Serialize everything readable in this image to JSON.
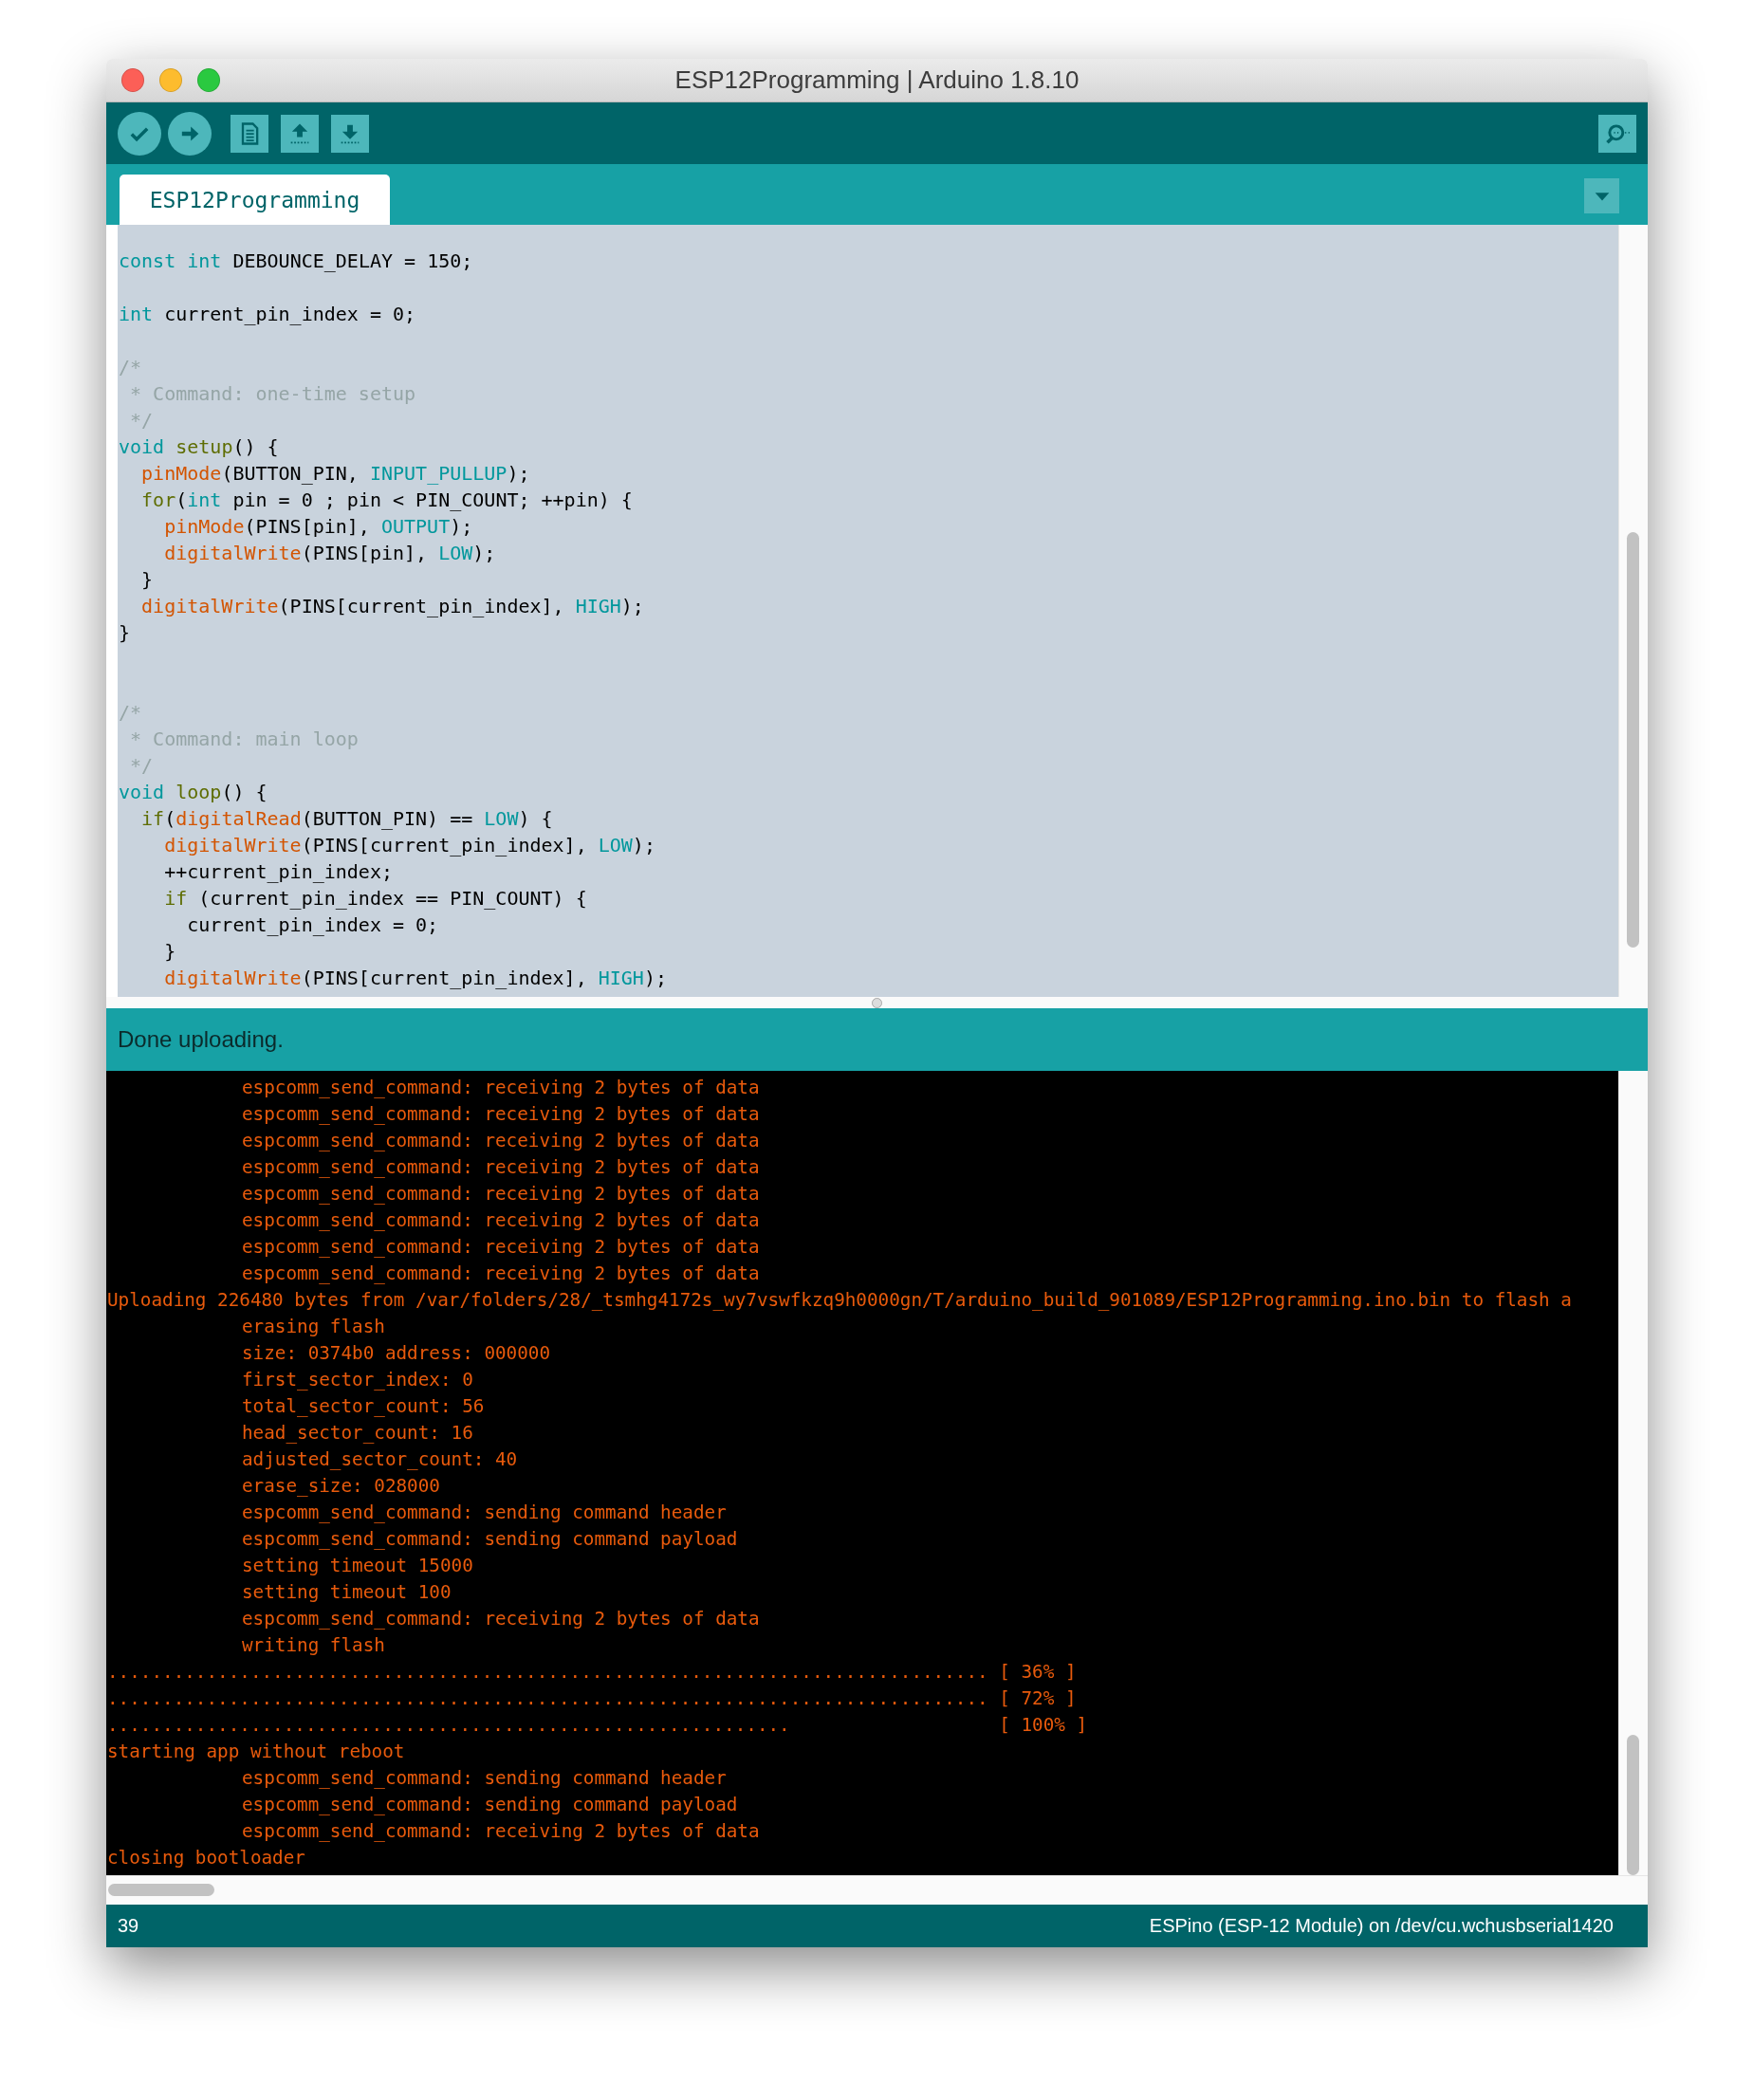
{
  "window": {
    "title": "ESP12Programming | Arduino 1.8.10"
  },
  "tabs": [
    {
      "label": "ESP12Programming",
      "selected": true
    }
  ],
  "editor": {
    "lines": [
      {
        "kind": "code",
        "tokens": [
          {
            "text": "const",
            "kind": "keyword"
          },
          {
            "text": " int",
            "kind": "keyword"
          },
          {
            "text": " DEBOUNCE_DELAY = 150;"
          }
        ]
      },
      {
        "kind": "blank"
      },
      {
        "kind": "code",
        "tokens": [
          {
            "text": "int",
            "kind": "keyword"
          },
          {
            "text": " current_pin_index = 0;"
          }
        ]
      },
      {
        "kind": "blank"
      },
      {
        "kind": "code",
        "tokens": [
          {
            "text": "/*",
            "kind": "comment"
          }
        ]
      },
      {
        "kind": "code",
        "tokens": [
          {
            "text": " * Command: one-time setup",
            "kind": "comment"
          }
        ]
      },
      {
        "kind": "code",
        "tokens": [
          {
            "text": " */",
            "kind": "comment"
          }
        ]
      },
      {
        "kind": "code",
        "tokens": [
          {
            "text": "void",
            "kind": "keyword"
          },
          {
            "text": " setup",
            "kind": "control"
          },
          {
            "text": "() {"
          }
        ]
      },
      {
        "kind": "code",
        "tokens": [
          {
            "text": "  pinMode",
            "kind": "function"
          },
          {
            "text": "(BUTTON_PIN, "
          },
          {
            "text": "INPUT_PULLUP",
            "kind": "keyword"
          },
          {
            "text": ");"
          }
        ]
      },
      {
        "kind": "code",
        "tokens": [
          {
            "text": "  for",
            "kind": "control"
          },
          {
            "text": "("
          },
          {
            "text": "int",
            "kind": "keyword"
          },
          {
            "text": " pin = 0 ; pin < PIN_COUNT; ++pin) {"
          }
        ]
      },
      {
        "kind": "code",
        "tokens": [
          {
            "text": "    pinMode",
            "kind": "function"
          },
          {
            "text": "(PINS[pin], "
          },
          {
            "text": "OUTPUT",
            "kind": "keyword"
          },
          {
            "text": ");"
          }
        ]
      },
      {
        "kind": "code",
        "tokens": [
          {
            "text": "    digitalWrite",
            "kind": "function"
          },
          {
            "text": "(PINS[pin], "
          },
          {
            "text": "LOW",
            "kind": "keyword"
          },
          {
            "text": ");"
          }
        ]
      },
      {
        "kind": "code",
        "tokens": [
          {
            "text": "  }"
          }
        ]
      },
      {
        "kind": "code",
        "tokens": [
          {
            "text": "  digitalWrite",
            "kind": "function"
          },
          {
            "text": "(PINS[current_pin_index], "
          },
          {
            "text": "HIGH",
            "kind": "keyword"
          },
          {
            "text": ");"
          }
        ]
      },
      {
        "kind": "code",
        "tokens": [
          {
            "text": "}"
          }
        ]
      },
      {
        "kind": "blank"
      },
      {
        "kind": "blank"
      },
      {
        "kind": "code",
        "tokens": [
          {
            "text": "/*",
            "kind": "comment"
          }
        ]
      },
      {
        "kind": "code",
        "tokens": [
          {
            "text": " * Command: main loop",
            "kind": "comment"
          }
        ]
      },
      {
        "kind": "code",
        "tokens": [
          {
            "text": " */",
            "kind": "comment"
          }
        ]
      },
      {
        "kind": "code",
        "tokens": [
          {
            "text": "void",
            "kind": "keyword"
          },
          {
            "text": " loop",
            "kind": "control"
          },
          {
            "text": "() {"
          }
        ]
      },
      {
        "kind": "code",
        "tokens": [
          {
            "text": "  if",
            "kind": "control"
          },
          {
            "text": "("
          },
          {
            "text": "digitalRead",
            "kind": "function"
          },
          {
            "text": "(BUTTON_PIN) == "
          },
          {
            "text": "LOW",
            "kind": "keyword"
          },
          {
            "text": ") {"
          }
        ]
      },
      {
        "kind": "code",
        "tokens": [
          {
            "text": "    digitalWrite",
            "kind": "function"
          },
          {
            "text": "(PINS[current_pin_index], "
          },
          {
            "text": "LOW",
            "kind": "keyword"
          },
          {
            "text": ");"
          }
        ]
      },
      {
        "kind": "code",
        "tokens": [
          {
            "text": "    ++current_pin_index;"
          }
        ]
      },
      {
        "kind": "code",
        "tokens": [
          {
            "text": "    if",
            "kind": "control"
          },
          {
            "text": " (current_pin_index == PIN_COUNT) {"
          }
        ]
      },
      {
        "kind": "code",
        "tokens": [
          {
            "text": "      current_pin_index = 0;"
          }
        ]
      },
      {
        "kind": "code",
        "tokens": [
          {
            "text": "    }"
          }
        ]
      },
      {
        "kind": "code",
        "tokens": [
          {
            "text": "    digitalWrite",
            "kind": "function"
          },
          {
            "text": "(PINS[current_pin_index], "
          },
          {
            "text": "HIGH",
            "kind": "keyword"
          },
          {
            "text": ");"
          }
        ]
      }
    ]
  },
  "status": {
    "message": "Done uploading."
  },
  "console": {
    "lines": [
      {
        "text": "espcomm_send_command: receiving 2 bytes of data",
        "indented": true
      },
      {
        "text": "espcomm_send_command: receiving 2 bytes of data",
        "indented": true
      },
      {
        "text": "espcomm_send_command: receiving 2 bytes of data",
        "indented": true
      },
      {
        "text": "espcomm_send_command: receiving 2 bytes of data",
        "indented": true
      },
      {
        "text": "espcomm_send_command: receiving 2 bytes of data",
        "indented": true
      },
      {
        "text": "espcomm_send_command: receiving 2 bytes of data",
        "indented": true
      },
      {
        "text": "espcomm_send_command: receiving 2 bytes of data",
        "indented": true
      },
      {
        "text": "espcomm_send_command: receiving 2 bytes of data",
        "indented": true
      },
      {
        "text": "Uploading 226480 bytes from /var/folders/28/_tsmhg4172s_wy7vswfkzq9h0000gn/T/arduino_build_901089/ESP12Programming.ino.bin to flash a",
        "indented": false
      },
      {
        "text": "erasing flash",
        "indented": true
      },
      {
        "text": "size: 0374b0 address: 000000",
        "indented": true
      },
      {
        "text": "first_sector_index: 0",
        "indented": true
      },
      {
        "text": "total_sector_count: 56",
        "indented": true
      },
      {
        "text": "head_sector_count: 16",
        "indented": true
      },
      {
        "text": "adjusted_sector_count: 40",
        "indented": true
      },
      {
        "text": "erase_size: 028000",
        "indented": true
      },
      {
        "text": "espcomm_send_command: sending command header",
        "indented": true
      },
      {
        "text": "espcomm_send_command: sending command payload",
        "indented": true
      },
      {
        "text": "setting timeout 15000",
        "indented": true
      },
      {
        "text": "setting timeout 100",
        "indented": true
      },
      {
        "text": "espcomm_send_command: receiving 2 bytes of data",
        "indented": true
      },
      {
        "text": "writing flash",
        "indented": true
      },
      {
        "text": "................................................................................ [ 36% ]",
        "indented": false
      },
      {
        "text": "................................................................................ [ 72% ]",
        "indented": false
      },
      {
        "text": "..............................................................                   [ 100% ]",
        "indented": false
      },
      {
        "text": "starting app without reboot",
        "indented": false
      },
      {
        "text": "espcomm_send_command: sending command header",
        "indented": true
      },
      {
        "text": "espcomm_send_command: sending command payload",
        "indented": true
      },
      {
        "text": "espcomm_send_command: receiving 2 bytes of data",
        "indented": true
      },
      {
        "text": "closing bootloader",
        "indented": false
      }
    ]
  },
  "footer": {
    "line_number": "39",
    "board": "ESPino (ESP-12 Module) on /dev/cu.wchusbserial1420"
  }
}
